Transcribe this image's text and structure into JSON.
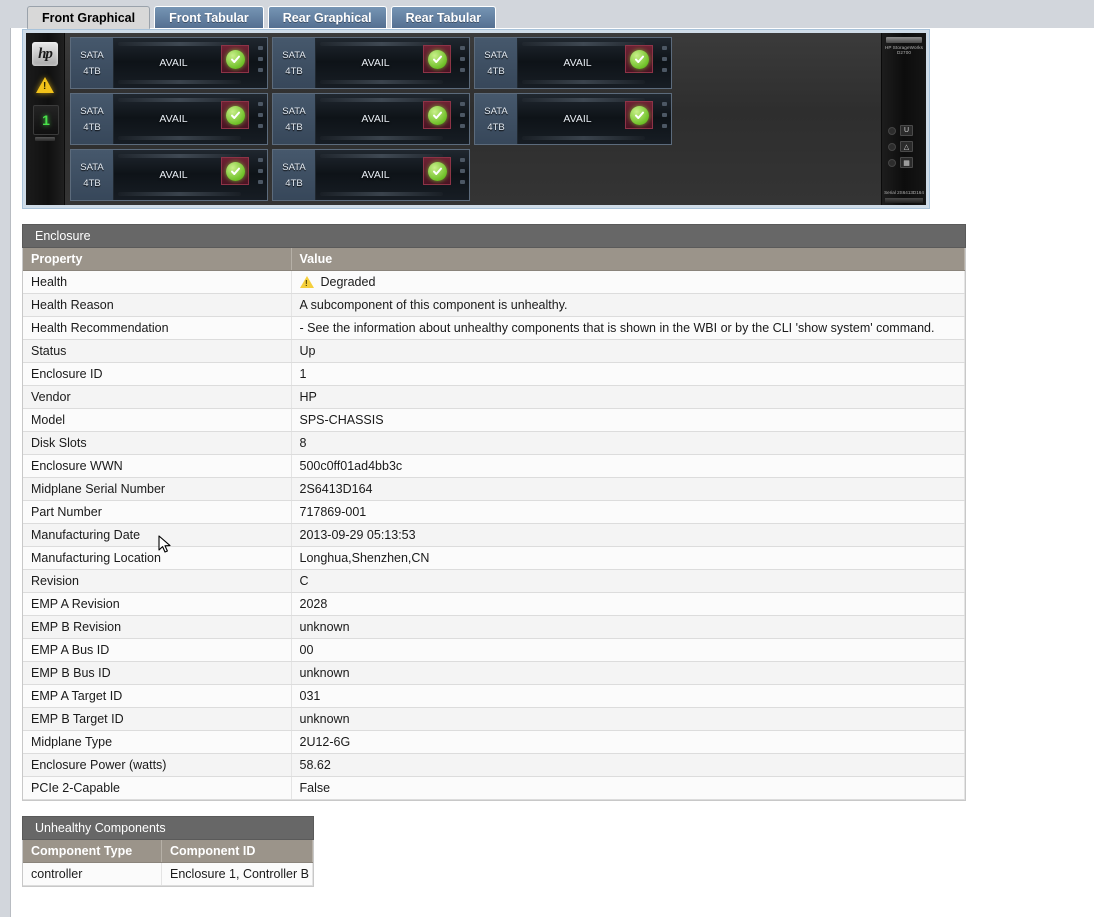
{
  "tabs": [
    {
      "label": "Front Graphical",
      "active": true
    },
    {
      "label": "Front Tabular",
      "active": false
    },
    {
      "label": "Rear Graphical",
      "active": false
    },
    {
      "label": "Rear Tabular",
      "active": false
    }
  ],
  "enclosure_graphic": {
    "vendor_logo": "hp",
    "fault_indicator": "warning-triangle",
    "enclosure_number": "1",
    "right_panel_brand": "HP\nStorageWorks\nD2700",
    "right_panel_serial": "Serial 2S6413D164",
    "led_labels": [
      "UID",
      "fault",
      "locate"
    ],
    "disk_rows": [
      [
        {
          "interface": "SATA",
          "capacity": "4TB",
          "state": "AVAIL",
          "health": "ok"
        },
        {
          "interface": "SATA",
          "capacity": "4TB",
          "state": "AVAIL",
          "health": "ok"
        },
        {
          "interface": "SATA",
          "capacity": "4TB",
          "state": "AVAIL",
          "health": "ok"
        }
      ],
      [
        {
          "interface": "SATA",
          "capacity": "4TB",
          "state": "AVAIL",
          "health": "ok"
        },
        {
          "interface": "SATA",
          "capacity": "4TB",
          "state": "AVAIL",
          "health": "ok"
        },
        {
          "interface": "SATA",
          "capacity": "4TB",
          "state": "AVAIL",
          "health": "ok"
        }
      ],
      [
        {
          "interface": "SATA",
          "capacity": "4TB",
          "state": "AVAIL",
          "health": "ok"
        },
        {
          "interface": "SATA",
          "capacity": "4TB",
          "state": "AVAIL",
          "health": "ok"
        }
      ]
    ]
  },
  "enclosure_panel": {
    "title": "Enclosure",
    "columns": [
      "Property",
      "Value"
    ],
    "rows": [
      {
        "property": "Health",
        "value": "Degraded",
        "icon": "warning-triangle-icon"
      },
      {
        "property": "Health Reason",
        "value": "A subcomponent of this component is unhealthy."
      },
      {
        "property": "Health Recommendation",
        "value": "- See the information about unhealthy components that is shown in the WBI or by the CLI 'show system' command."
      },
      {
        "property": "Status",
        "value": "Up"
      },
      {
        "property": "Enclosure ID",
        "value": "1"
      },
      {
        "property": "Vendor",
        "value": "HP"
      },
      {
        "property": "Model",
        "value": "SPS-CHASSIS"
      },
      {
        "property": "Disk Slots",
        "value": "8"
      },
      {
        "property": "Enclosure WWN",
        "value": "500c0ff01ad4bb3c"
      },
      {
        "property": "Midplane Serial Number",
        "value": "2S6413D164"
      },
      {
        "property": "Part Number",
        "value": "717869-001"
      },
      {
        "property": "Manufacturing Date",
        "value": "2013-09-29 05:13:53"
      },
      {
        "property": "Manufacturing Location",
        "value": "Longhua,Shenzhen,CN"
      },
      {
        "property": "Revision",
        "value": "C"
      },
      {
        "property": "EMP A Revision",
        "value": "2028"
      },
      {
        "property": "EMP B Revision",
        "value": "unknown"
      },
      {
        "property": "EMP A Bus ID",
        "value": "00"
      },
      {
        "property": "EMP B Bus ID",
        "value": "unknown"
      },
      {
        "property": "EMP A Target ID",
        "value": "031"
      },
      {
        "property": "EMP B Target ID",
        "value": "unknown"
      },
      {
        "property": "Midplane Type",
        "value": "2U12-6G"
      },
      {
        "property": "Enclosure Power (watts)",
        "value": "58.62"
      },
      {
        "property": "PCIe 2-Capable",
        "value": "False"
      }
    ]
  },
  "unhealthy_panel": {
    "title": "Unhealthy Components",
    "columns": [
      "Component Type",
      "Component ID"
    ],
    "rows": [
      {
        "type": "controller",
        "id": "Enclosure 1, Controller B"
      }
    ]
  },
  "colors": {
    "tab_active_bg": "#d8d8d8",
    "tab_inactive_bg": "#5f7d9f",
    "panel_title_bg": "#676767",
    "table_header_bg": "#9b948a",
    "warning_yellow": "#f2c21a",
    "status_ok_green": "#6fc028",
    "status_bay_red": "#6d2233",
    "page_bg": "#d2d6dc"
  }
}
